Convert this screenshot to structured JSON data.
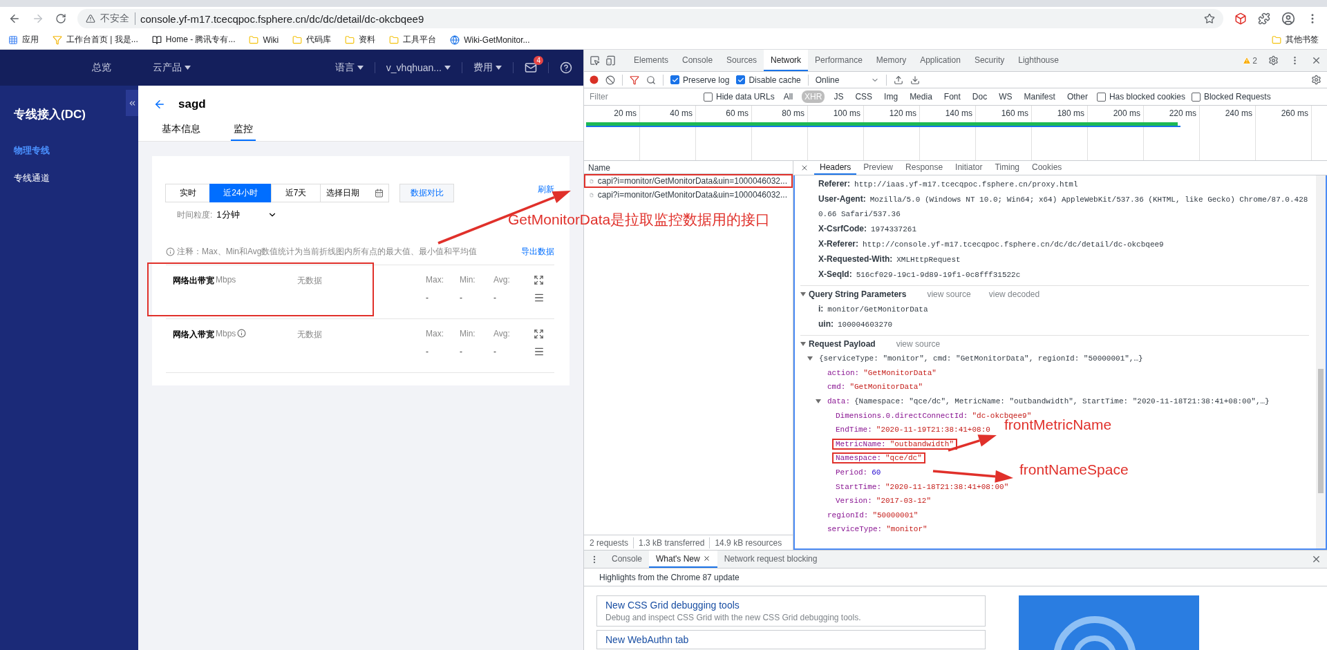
{
  "browser": {
    "security_label": "不安全",
    "url": "console.yf-m17.tcecqpoc.fsphere.cn/dc/dc/detail/dc-okcbqee9",
    "bookmarks": [
      {
        "label": "应用",
        "kind": "apps"
      },
      {
        "label": "工作台首页 | 我是...",
        "kind": "funnel"
      },
      {
        "label": "Home - 腾讯专有...",
        "kind": "book"
      },
      {
        "label": "Wiki",
        "kind": "folder"
      },
      {
        "label": "代码库",
        "kind": "folder"
      },
      {
        "label": "资料",
        "kind": "folder"
      },
      {
        "label": "工具平台",
        "kind": "folder"
      },
      {
        "label": "Wiki-GetMonitor...",
        "kind": "site"
      }
    ],
    "other_bookmarks": "其他书签"
  },
  "console": {
    "nav": {
      "items": [
        "总览",
        "云产品"
      ],
      "language": "语言",
      "user": "v_vhqhuan...",
      "billing": "费用",
      "mail_badge": "4"
    },
    "sidebar": {
      "title": "专线接入(DC)",
      "items": [
        {
          "label": "物理专线",
          "selected": true
        },
        {
          "label": "专线通道",
          "selected": false
        }
      ]
    },
    "page": {
      "title": "sagd",
      "tabs": [
        {
          "label": "基本信息",
          "selected": false
        },
        {
          "label": "监控",
          "selected": true
        }
      ],
      "time_ranges": [
        {
          "label": "实时",
          "selected": false
        },
        {
          "label": "近24小时",
          "selected": true
        },
        {
          "label": "近7天",
          "selected": false
        }
      ],
      "date_picker": "选择日期",
      "compare": "数据对比",
      "refresh": "刷新",
      "granularity_label": "时间粒度:",
      "granularity": "1分钟",
      "note": "注释：Max、Min和Avg数值统计为当前折线图内所有点的最大值、最小值和平均值",
      "export": "导出数据",
      "metrics": [
        {
          "name": "网络出带宽",
          "unit": "Mbps",
          "info": false,
          "status": "无数据",
          "highlighted": true,
          "stats": [
            {
              "label": "Max:",
              "value": "-"
            },
            {
              "label": "Min:",
              "value": "-"
            },
            {
              "label": "Avg:",
              "value": "-"
            }
          ]
        },
        {
          "name": "网络入带宽",
          "unit": "Mbps",
          "info": true,
          "status": "无数据",
          "highlighted": false,
          "stats": [
            {
              "label": "Max:",
              "value": "-"
            },
            {
              "label": "Min:",
              "value": "-"
            },
            {
              "label": "Avg:",
              "value": "-"
            }
          ]
        }
      ]
    }
  },
  "devtools": {
    "tabs": [
      {
        "label": "Elements",
        "selected": false
      },
      {
        "label": "Console",
        "selected": false
      },
      {
        "label": "Sources",
        "selected": false
      },
      {
        "label": "Network",
        "selected": true
      },
      {
        "label": "Performance",
        "selected": false
      },
      {
        "label": "Memory",
        "selected": false
      },
      {
        "label": "Application",
        "selected": false
      },
      {
        "label": "Security",
        "selected": false
      },
      {
        "label": "Lighthouse",
        "selected": false
      }
    ],
    "warnings": "2",
    "toolbar": {
      "preserve_log": {
        "label": "Preserve log",
        "checked": true
      },
      "disable_cache": {
        "label": "Disable cache",
        "checked": true
      },
      "throttling": "Online"
    },
    "filter": {
      "placeholder": "Filter",
      "hide_data_urls": {
        "label": "Hide data URLs",
        "checked": false
      },
      "types": [
        {
          "label": "All",
          "selected": false
        },
        {
          "label": "XHR",
          "selected": true
        },
        {
          "label": "JS",
          "selected": false
        },
        {
          "label": "CSS",
          "selected": false
        },
        {
          "label": "Img",
          "selected": false
        },
        {
          "label": "Media",
          "selected": false
        },
        {
          "label": "Font",
          "selected": false
        },
        {
          "label": "Doc",
          "selected": false
        },
        {
          "label": "WS",
          "selected": false
        },
        {
          "label": "Manifest",
          "selected": false
        },
        {
          "label": "Other",
          "selected": false
        }
      ],
      "has_blocked_cookies": {
        "label": "Has blocked cookies",
        "checked": false
      },
      "blocked_requests": {
        "label": "Blocked Requests",
        "checked": false
      }
    },
    "timeline": {
      "ticks": [
        "20 ms",
        "40 ms",
        "60 ms",
        "80 ms",
        "100 ms",
        "120 ms",
        "140 ms",
        "160 ms",
        "180 ms",
        "200 ms",
        "220 ms",
        "240 ms",
        "260 ms"
      ]
    },
    "requests": {
      "header": "Name",
      "rows": [
        {
          "name": "capi?i=monitor/GetMonitorData&uin=1000046032...",
          "highlighted": true
        },
        {
          "name": "capi?i=monitor/GetMonitorData&uin=1000046032...",
          "highlighted": false
        }
      ],
      "status": [
        "2 requests",
        "1.3 kB transferred",
        "14.9 kB resources"
      ]
    },
    "detail": {
      "tabs": [
        {
          "label": "Headers",
          "selected": true
        },
        {
          "label": "Preview",
          "selected": false
        },
        {
          "label": "Response",
          "selected": false
        },
        {
          "label": "Initiator",
          "selected": false
        },
        {
          "label": "Timing",
          "selected": false
        },
        {
          "label": "Cookies",
          "selected": false
        }
      ],
      "request_headers": [
        {
          "name": "Referer:",
          "value": "http://iaas.yf-m17.tcecqpoc.fsphere.cn/proxy.html"
        },
        {
          "name": "User-Agent:",
          "value": "Mozilla/5.0 (Windows NT 10.0; Win64; x64) AppleWebKit/537.36 (KHTML, like Gecko) Chrome/87.0.4280.66 Safari/537.36"
        },
        {
          "name": "X-CsrfCode:",
          "value": "1974337261"
        },
        {
          "name": "X-Referer:",
          "value": "http://console.yf-m17.tcecqpoc.fsphere.cn/dc/dc/detail/dc-okcbqee9"
        },
        {
          "name": "X-Requested-With:",
          "value": "XMLHttpRequest"
        },
        {
          "name": "X-SeqId:",
          "value": "516cf029-19c1-9d89-19f1-0c8fff31522c"
        }
      ],
      "query": {
        "title": "Query String Parameters",
        "expanded": true,
        "actions": [
          "view source",
          "view decoded"
        ],
        "params": [
          {
            "name": "i:",
            "value": "monitor/GetMonitorData"
          },
          {
            "name": "uin:",
            "value": "100004603270"
          }
        ]
      },
      "payload": {
        "title": "Request Payload",
        "expanded": true,
        "actions": [
          "view source"
        ],
        "tree": {
          "value": "{serviceType: \"monitor\", cmd: \"GetMonitorData\", regionId: \"50000001\",…}",
          "kind": "object",
          "expanded": true,
          "children": [
            {
              "key": "action:",
              "value": "\"GetMonitorData\"",
              "kind": "string"
            },
            {
              "key": "cmd:",
              "value": "\"GetMonitorData\"",
              "kind": "string"
            },
            {
              "key": "data:",
              "value": "{Namespace: \"qce/dc\", MetricName: \"outbandwidth\", StartTime: \"2020-11-18T21:38:41+08:00\",…}",
              "kind": "object",
              "expanded": true,
              "children": [
                {
                  "key": "Dimensions.0.directConnectId:",
                  "value": "\"dc-okcbqee9\"",
                  "kind": "string",
                  "highlighted": false
                },
                {
                  "key": "EndTime:",
                  "value": "\"2020-11-19T21:38:41+08:0",
                  "kind": "string",
                  "highlighted": false
                },
                {
                  "key": "MetricName:",
                  "value": "\"outbandwidth\"",
                  "kind": "string",
                  "highlighted": true
                },
                {
                  "key": "Namespace:",
                  "value": "\"qce/dc\"",
                  "kind": "string",
                  "highlighted": true
                },
                {
                  "key": "Period:",
                  "value": "60",
                  "kind": "number",
                  "highlighted": false
                },
                {
                  "key": "StartTime:",
                  "value": "\"2020-11-18T21:38:41+08:00\"",
                  "kind": "string",
                  "highlighted": false
                },
                {
                  "key": "Version:",
                  "value": "\"2017-03-12\"",
                  "kind": "string",
                  "highlighted": false
                }
              ]
            },
            {
              "key": "regionId:",
              "value": "\"50000001\"",
              "kind": "string"
            },
            {
              "key": "serviceType:",
              "value": "\"monitor\"",
              "kind": "string"
            }
          ]
        }
      }
    },
    "drawer": {
      "tabs": [
        {
          "label": "Console",
          "selected": false,
          "closable": false
        },
        {
          "label": "What's New",
          "selected": true,
          "closable": true
        },
        {
          "label": "Network request blocking",
          "selected": false,
          "closable": false
        }
      ],
      "highlights_title": "Highlights from the Chrome 87 update",
      "cards": [
        {
          "title": "New CSS Grid debugging tools",
          "description": "Debug and inspect CSS Grid with the new CSS Grid debugging tools."
        },
        {
          "title": "New WebAuthn tab"
        }
      ]
    }
  },
  "annotations": {
    "callout": "GetMonitorData是拉取监控数据用的接口",
    "labels": [
      "frontMetricName",
      "frontNameSpace"
    ]
  }
}
